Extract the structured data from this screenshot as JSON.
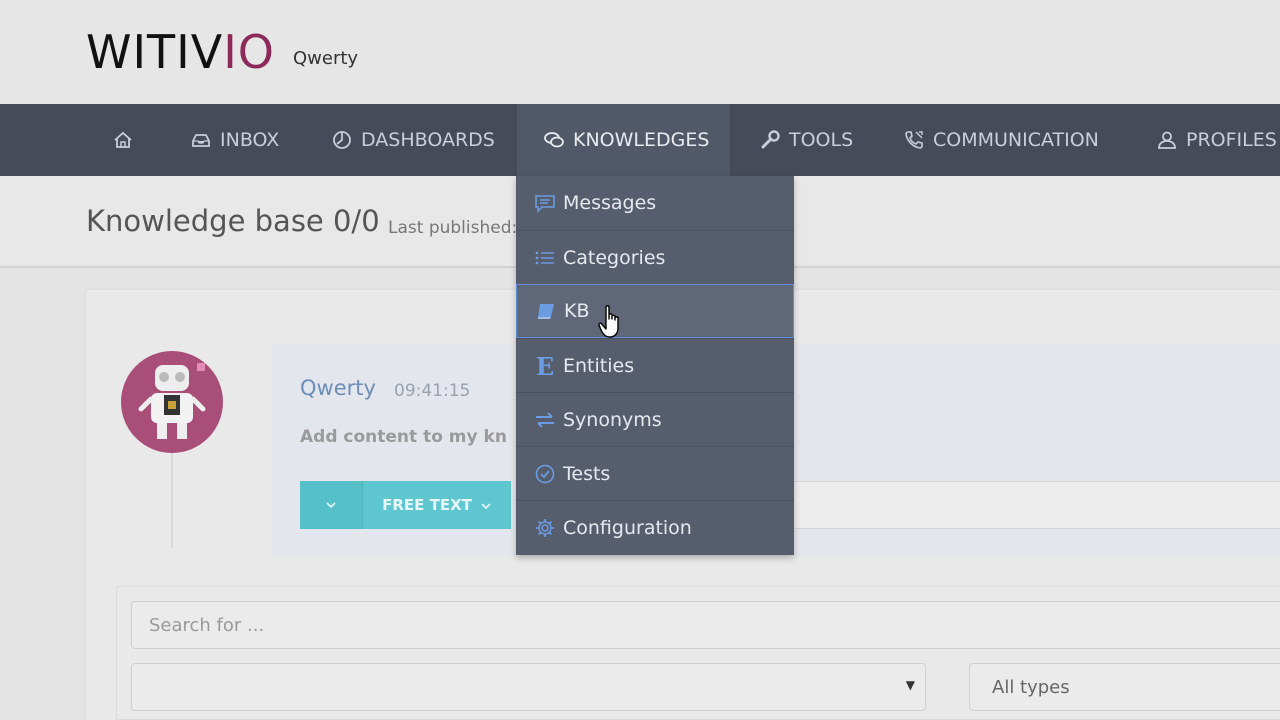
{
  "header": {
    "logo_main": "WITIV",
    "logo_accent": "IO",
    "logo_sub": "Qwerty"
  },
  "nav": {
    "items": [
      {
        "label": "",
        "icon": "home-icon"
      },
      {
        "label": "INBOX",
        "icon": "inbox-icon"
      },
      {
        "label": "DASHBOARDS",
        "icon": "dashboard-icon"
      },
      {
        "label": "KNOWLEDGES",
        "icon": "chat-bubbles-icon",
        "active": true
      },
      {
        "label": "TOOLS",
        "icon": "wrench-icon"
      },
      {
        "label": "COMMUNICATION",
        "icon": "phone-icon"
      },
      {
        "label": "PROFILES",
        "icon": "user-icon"
      }
    ]
  },
  "page": {
    "title": "Knowledge base 0/0",
    "subtitle": "Last published:"
  },
  "chat": {
    "name": "Qwerty",
    "time": "09:41:15",
    "message": "Add content to my kn",
    "free_text_label": "FREE TEXT"
  },
  "search": {
    "placeholder": "Search for ...",
    "type_select": "All types"
  },
  "dropdown": {
    "items": [
      {
        "label": "Messages",
        "icon": "message-icon"
      },
      {
        "label": "Categories",
        "icon": "list-icon"
      },
      {
        "label": "KB",
        "icon": "book-icon",
        "hovered": true
      },
      {
        "label": "Entities",
        "icon": "entity-icon"
      },
      {
        "label": "Synonyms",
        "icon": "swap-icon"
      },
      {
        "label": "Tests",
        "icon": "check-circle-icon"
      },
      {
        "label": "Configuration",
        "icon": "gear-icon"
      }
    ]
  },
  "colors": {
    "nav_bg": "#454b59",
    "dropdown_bg": "#565d6d",
    "accent": "#5dc6cf",
    "brand": "#8b2a5a"
  }
}
